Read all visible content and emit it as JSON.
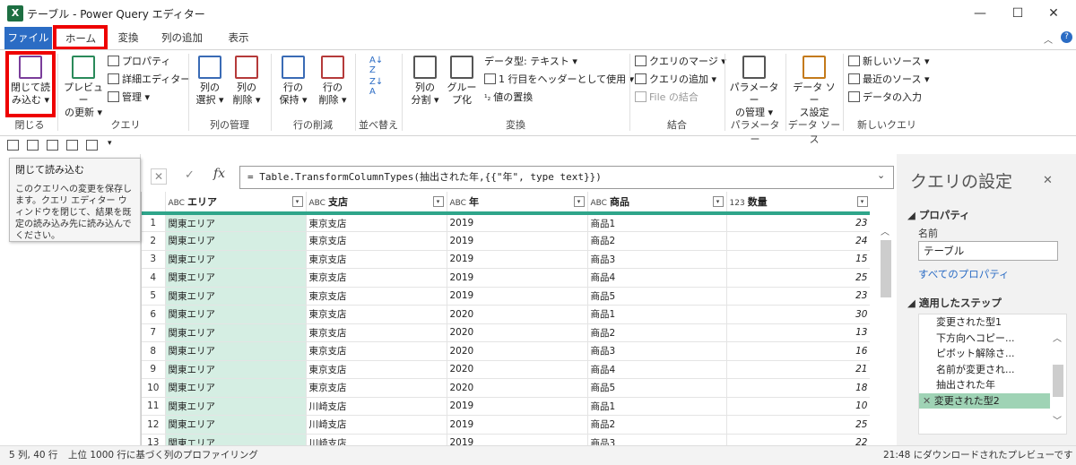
{
  "window": {
    "title": "テーブル - Power Query エディター",
    "app_icon": "X",
    "controls": [
      "—",
      "☐",
      "✕"
    ]
  },
  "tabs": [
    "ファイル",
    "ホーム",
    "変換",
    "列の追加",
    "表示"
  ],
  "ribbon": {
    "close_load": "閉じて読\nみ込む ▾",
    "preview_refresh": "プレビュー\nの更新 ▾",
    "properties": "プロパティ",
    "advanced_editor": "詳細エディター",
    "manage": "管理 ▾",
    "choose_columns": "列の\n選択 ▾",
    "remove_columns": "列の\n削除 ▾",
    "keep_rows": "行の\n保持 ▾",
    "remove_rows": "行の\n削除 ▾",
    "split_column": "列の\n分割 ▾",
    "group_by": "グルー\nプ化",
    "data_type": "データ型: テキスト ▾",
    "first_row_header": "1 行目をヘッダーとして使用 ▾",
    "replace_values": "値の置換",
    "merge_queries": "クエリのマージ ▾",
    "append_queries": "クエリの追加 ▾",
    "combine_files": "File の結合",
    "parameters": "パラメーター\nの管理 ▾",
    "data_source": "データ ソー\nス設定",
    "new_source": "新しいソース ▾",
    "recent_sources": "最近のソース ▾",
    "enter_data": "データの入力",
    "groups": [
      "閉じる",
      "クエリ",
      "列の管理",
      "行の削減",
      "並べ替え",
      "変換",
      "結合",
      "パラメーター",
      "データ ソース",
      "新しいクエリ"
    ]
  },
  "tooltip": {
    "title": "閉じて読み込む",
    "body": "このクエリへの変更を保存します。クエリ エディター ウィンドウを閉じて、結果を既定の読み込み先に読み込んでください。"
  },
  "formula": {
    "fx": "fx",
    "text": "= Table.TransformColumnTypes(抽出された年,{{\"年\", type text}})"
  },
  "grid": {
    "columns": [
      {
        "type": "ABC",
        "name": "エリア"
      },
      {
        "type": "ABC",
        "name": "支店"
      },
      {
        "type": "ABC",
        "name": "年"
      },
      {
        "type": "ABC",
        "name": "商品"
      },
      {
        "type": "123",
        "name": "数量"
      }
    ],
    "rows": [
      [
        "1",
        "関東エリア",
        "東京支店",
        "2019",
        "商品1",
        "23"
      ],
      [
        "2",
        "関東エリア",
        "東京支店",
        "2019",
        "商品2",
        "24"
      ],
      [
        "3",
        "関東エリア",
        "東京支店",
        "2019",
        "商品3",
        "15"
      ],
      [
        "4",
        "関東エリア",
        "東京支店",
        "2019",
        "商品4",
        "25"
      ],
      [
        "5",
        "関東エリア",
        "東京支店",
        "2019",
        "商品5",
        "23"
      ],
      [
        "6",
        "関東エリア",
        "東京支店",
        "2020",
        "商品1",
        "30"
      ],
      [
        "7",
        "関東エリア",
        "東京支店",
        "2020",
        "商品2",
        "13"
      ],
      [
        "8",
        "関東エリア",
        "東京支店",
        "2020",
        "商品3",
        "16"
      ],
      [
        "9",
        "関東エリア",
        "東京支店",
        "2020",
        "商品4",
        "21"
      ],
      [
        "10",
        "関東エリア",
        "東京支店",
        "2020",
        "商品5",
        "18"
      ],
      [
        "11",
        "関東エリア",
        "川崎支店",
        "2019",
        "商品1",
        "10"
      ],
      [
        "12",
        "関東エリア",
        "川崎支店",
        "2019",
        "商品2",
        "25"
      ],
      [
        "13",
        "関東エリア",
        "川崎支店",
        "2019",
        "商品3",
        "22"
      ]
    ]
  },
  "settings": {
    "title": "クエリの設定",
    "properties_header": "◢ プロパティ",
    "name_label": "名前",
    "name_value": "テーブル",
    "all_properties": "すべてのプロパティ",
    "steps_header": "◢ 適用したステップ",
    "steps": [
      "変更された型1",
      "下方向へコピー...",
      "ピボット解除さ...",
      "名前が変更され...",
      "抽出された年",
      "変更された型2"
    ]
  },
  "status": {
    "left": "5 列, 40 行",
    "profiling": "上位 1000 行に基づく列のプロファイリング",
    "right": "21:48 にダウンロードされたプレビューです"
  }
}
